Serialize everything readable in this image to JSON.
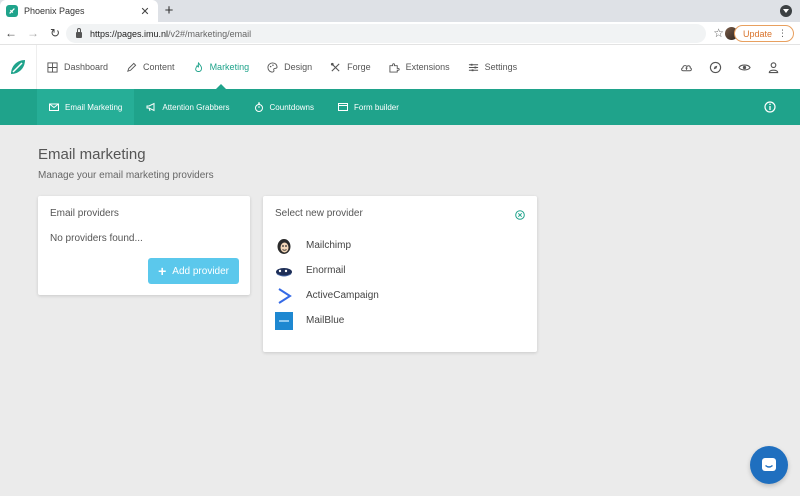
{
  "browser": {
    "tab_title": "Phoenix Pages",
    "tab_close": "✕",
    "new_tab": "+",
    "url_host": "https://pages.imu.nl",
    "url_path": "/v2#/marketing/email",
    "update_label": "Update"
  },
  "appnav": {
    "items": [
      {
        "label": "Dashboard",
        "icon": "grid-icon"
      },
      {
        "label": "Content",
        "icon": "pencil-icon"
      },
      {
        "label": "Marketing",
        "icon": "flame-icon",
        "active": true
      },
      {
        "label": "Design",
        "icon": "palette-icon"
      },
      {
        "label": "Forge",
        "icon": "tools-icon"
      },
      {
        "label": "Extensions",
        "icon": "puzzle-icon"
      },
      {
        "label": "Settings",
        "icon": "sliders-icon"
      }
    ],
    "right_icons": [
      "cloud-upload-icon",
      "compass-icon",
      "eye-icon",
      "user-icon"
    ]
  },
  "subnav": {
    "items": [
      {
        "label": "Email Marketing",
        "icon": "envelope-icon",
        "active": true
      },
      {
        "label": "Attention Grabbers",
        "icon": "megaphone-icon"
      },
      {
        "label": "Countdowns",
        "icon": "stopwatch-icon"
      },
      {
        "label": "Form builder",
        "icon": "form-icon"
      }
    ]
  },
  "page": {
    "title": "Email marketing",
    "subtitle": "Manage your email marketing providers"
  },
  "providers_card": {
    "title": "Email providers",
    "empty_text": "No providers found...",
    "add_button": "Add provider"
  },
  "select_card": {
    "title": "Select new provider",
    "providers": [
      "Mailchimp",
      "Enormail",
      "ActiveCampaign",
      "MailBlue"
    ]
  },
  "colors": {
    "accent": "#1fa38b",
    "add_button": "#5bc8ec",
    "chat": "#1f6fbf"
  }
}
